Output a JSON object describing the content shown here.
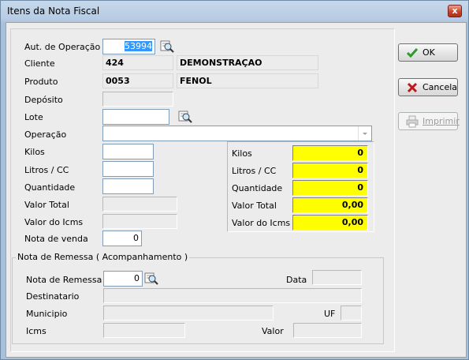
{
  "window": {
    "title": "Itens da Nota Fiscal",
    "close_glyph": "x"
  },
  "form": {
    "aut_operacao": {
      "label": "Aut. de Operação",
      "value": "53994"
    },
    "cliente": {
      "label": "Cliente",
      "code": "424",
      "name": "DEMONSTRAÇAO"
    },
    "produto": {
      "label": "Produto",
      "code": "0053",
      "name": "FENOL"
    },
    "deposito": {
      "label": "Depósito",
      "value": ""
    },
    "lote": {
      "label": "Lote",
      "value": ""
    },
    "operacao": {
      "label": "Operação",
      "value": ""
    },
    "kilos": {
      "label": "Kilos",
      "value": ""
    },
    "litros": {
      "label": "Litros / CC",
      "value": ""
    },
    "quantidade": {
      "label": "Quantidade",
      "value": ""
    },
    "valor_total": {
      "label": "Valor Total",
      "value": ""
    },
    "valor_icms": {
      "label": "Valor do Icms",
      "value": ""
    },
    "nota_venda": {
      "label": "Nota de venda",
      "value": "0"
    }
  },
  "totals": [
    {
      "label": "Kilos",
      "value": "0"
    },
    {
      "label": "Litros / CC",
      "value": "0"
    },
    {
      "label": "Quantidade",
      "value": "0"
    },
    {
      "label": "Valor Total",
      "value": "0,00"
    },
    {
      "label": "Valor do Icms",
      "value": "0,00"
    }
  ],
  "remessa": {
    "group_title": "Nota de Remessa ( Acompanhamento )",
    "nota_label": "Nota de Remessa",
    "nota_value": "0",
    "data_label": "Data",
    "destinatario_label": "Destinatario",
    "municipio_label": "Municipio",
    "uf_label": "UF",
    "icms_label": "Icms",
    "valor_label": "Valor"
  },
  "buttons": {
    "ok": "OK",
    "cancela": "Cancela",
    "imprimir": "Imprimir"
  },
  "colors": {
    "highlight": "#ffff00",
    "selection": "#3399ff",
    "ok_check": "#2e9a2e",
    "cancel_x": "#c0171b"
  }
}
